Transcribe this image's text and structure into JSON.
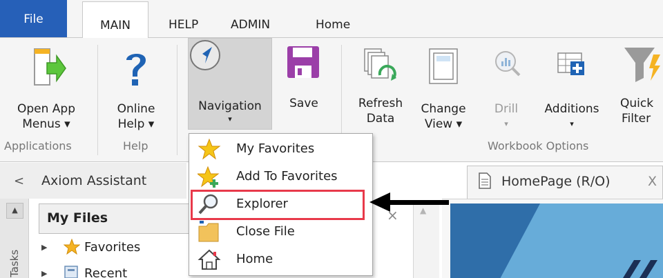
{
  "tabs": {
    "file": "File",
    "main": "MAIN",
    "help": "HELP",
    "admin": "ADMIN",
    "home": "Home"
  },
  "ribbon": {
    "open_app_menus": {
      "line1": "Open App",
      "line2": "Menus ▾"
    },
    "online_help": {
      "line1": "Online",
      "line2": "Help ▾"
    },
    "navigation": {
      "line1": "Navigation",
      "caret": "▾"
    },
    "save": "Save",
    "refresh_data": {
      "line1": "Refresh",
      "line2": "Data"
    },
    "change_view": {
      "line1": "Change",
      "line2": "View ▾"
    },
    "drill": {
      "line1": "Drill",
      "caret": "▾"
    },
    "additions": {
      "line1": "Additions",
      "caret": "▾"
    },
    "quick_filter": {
      "line1": "Quick",
      "line2": "Filter"
    },
    "groups": {
      "applications": "Applications",
      "help": "Help",
      "workbook_options": "Workbook Options"
    }
  },
  "assistant": {
    "chevron": "<",
    "title": "Axiom Assistant",
    "vertical_tab": "Tasks",
    "my_files": {
      "title": "My Files",
      "close": "×",
      "items": [
        {
          "label": "Favorites"
        },
        {
          "label": "Recent"
        }
      ]
    }
  },
  "document": {
    "tab_title": "HomePage (R/O)",
    "tab_close": "X"
  },
  "navigation_menu": {
    "items": [
      {
        "label": "My Favorites",
        "icon": "star-icon"
      },
      {
        "label": "Add To Favorites",
        "icon": "add-star-icon"
      },
      {
        "label": "Explorer",
        "icon": "magnifier-icon",
        "highlighted": true
      },
      {
        "label": "Close File",
        "icon": "folder-icon"
      },
      {
        "label": "Home",
        "icon": "house-icon"
      }
    ]
  },
  "colors": {
    "file_tab": "#2660b8",
    "highlight": "#e8394a",
    "save_icon": "#9b3fa8",
    "help_icon": "#1f63b4",
    "arrow_green": "#5cc63c"
  }
}
